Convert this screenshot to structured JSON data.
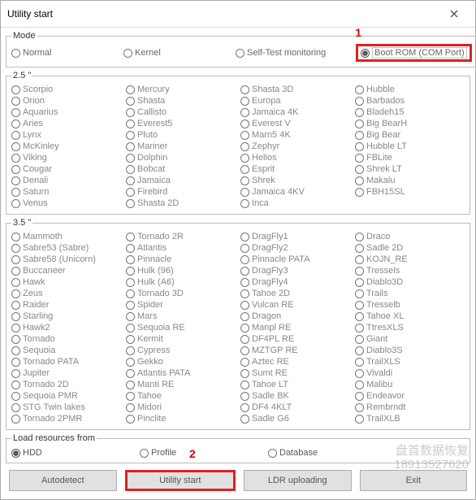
{
  "window": {
    "title": "Utility start"
  },
  "annotations": {
    "a1": "1",
    "a2": "2"
  },
  "mode": {
    "legend": "Mode",
    "opts": [
      "Normal",
      "Kernel",
      "Self-Test monitoring",
      "Boot ROM (COM Port)"
    ],
    "selected": 3
  },
  "drives25": {
    "legend": "2.5 \"",
    "cols": [
      [
        "Scorpio",
        "Orion",
        "Aquarius",
        "Aries",
        "Lynx",
        "McKinley",
        "Viking",
        "Cougar",
        "Denali",
        "Saturn",
        "Venus"
      ],
      [
        "Mercury",
        "Shasta",
        "Callisto",
        "Everest5",
        "Pluto",
        "Mariner",
        "Dolphin",
        "Bobcat",
        "Jamaica",
        "Firebird",
        "Shasta 2D"
      ],
      [
        "Shasta 3D",
        "Europa",
        "Jamaica 4K",
        "Everest V",
        "Marn5 4K",
        "Zephyr",
        "Helios",
        "Esprit",
        "Shrek",
        "Jamaica 4KV",
        "Inca"
      ],
      [
        "Hubble",
        "Barbados",
        "Bladeh15",
        "Big BearH",
        "Big Bear",
        "Hubble LT",
        "FBLite",
        "Shrek LT",
        "Makalu",
        "FBH15SL"
      ]
    ]
  },
  "drives35": {
    "legend": "3.5 \"",
    "cols": [
      [
        "Mammoth",
        "Sabre53 (Sabre)",
        "Sabre58 (Unicorn)",
        "Buccaneer",
        "Hawk",
        "Zeus",
        "Raider",
        "Starling",
        "Hawk2",
        "Tornado",
        "Sequoia",
        "Tornado PATA",
        "Jupiter",
        "Tornado 2D",
        "Sequoia PMR",
        "STG Twin lakes",
        "Tornado 2PMR"
      ],
      [
        "Tornado 2R",
        "Atlantis",
        "Pinnacle",
        "Hulk (96)",
        "Hulk (A6)",
        "Tornado 3D",
        "Spider",
        "Mars",
        "Sequoia RE",
        "Kermit",
        "Cypress",
        "Gekko",
        "Atlantis PATA",
        "Manti RE",
        "Tahoe",
        "Midori",
        "Pinclite"
      ],
      [
        "DragFly1",
        "DragFly2",
        "Pinnacle PATA",
        "DragFly3",
        "DragFly4",
        "Tahoe 2D",
        "Vulcan RE",
        "Dragon",
        "Manpl RE",
        "DF4PL RE",
        "MZTGP RE",
        "Aztec RE",
        "Sumt RE",
        "Tahoe LT",
        "Sadle BK",
        "DF4 4KLT",
        "Sadle G6"
      ],
      [
        "Draco",
        "Sadle 2D",
        "KOJN_RE",
        "Tressels",
        "Diablo3D",
        "Trails",
        "Tresselb",
        "Tahoe XL",
        "TtresXLS",
        "Giant",
        "Diablo3S",
        "TrailXLS",
        "Vivaldi",
        "Malibu",
        "Endeavor",
        "Rembrndt",
        "TrailXLB"
      ]
    ]
  },
  "load": {
    "legend": "Load resources from",
    "opts": [
      "HDD",
      "Profile",
      "Database"
    ],
    "selected": 0
  },
  "buttons": {
    "autodetect": "Autodetect",
    "utility_start": "Utility start",
    "ldr": "LDR uploading",
    "exit": "Exit"
  },
  "watermark": {
    "line1": "盘首数据恢复",
    "line2": "18913527620"
  }
}
